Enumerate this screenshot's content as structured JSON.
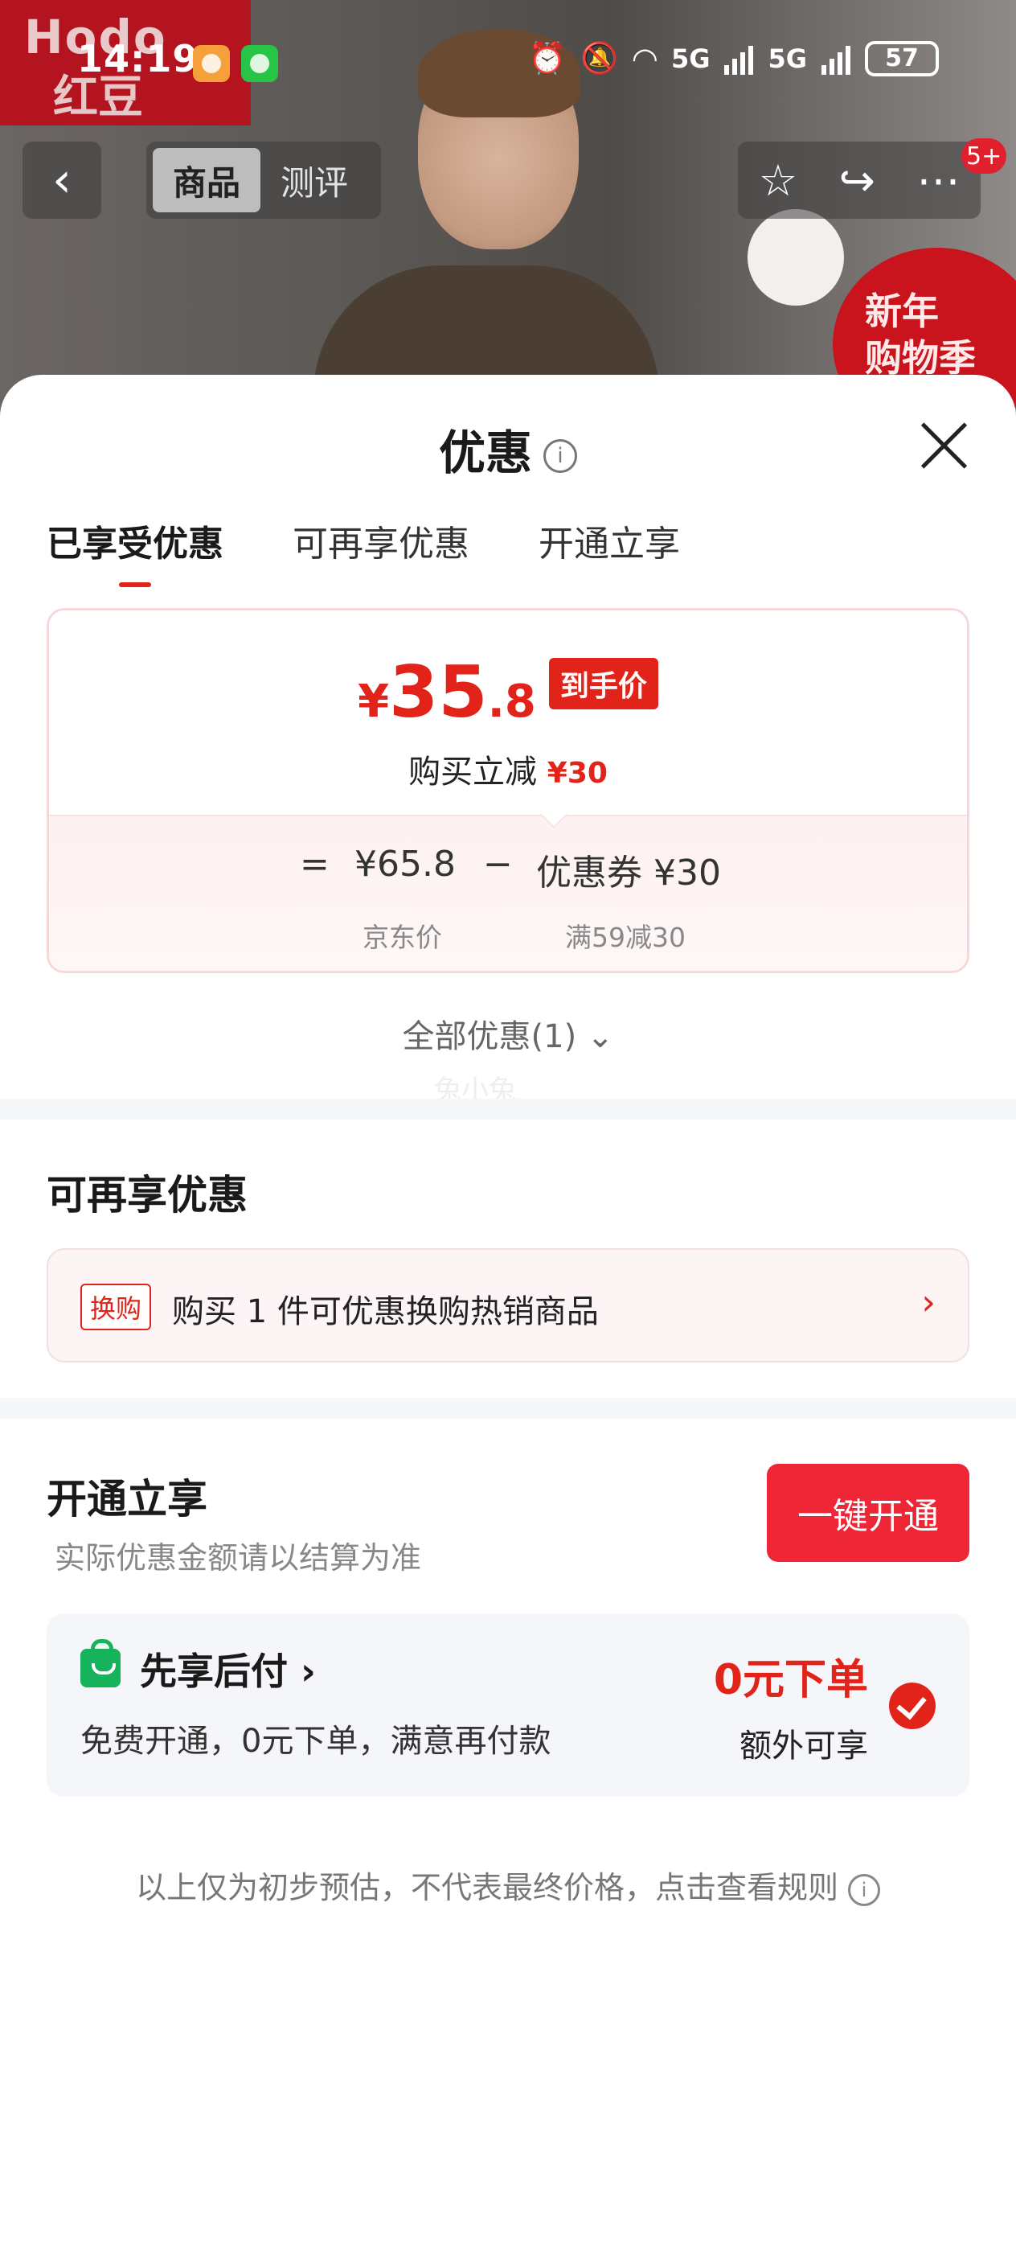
{
  "status_bar": {
    "time": "14:19",
    "network_1": "5G",
    "network_2": "5G",
    "battery": "57"
  },
  "banner": {
    "brand_top": "Hodo",
    "brand_cn": "红豆",
    "promo": [
      "新年",
      "购物季"
    ],
    "badge_count": "5+"
  },
  "top_nav": {
    "back_icon": "back-arrow-icon",
    "tabs": [
      "商品",
      "测评"
    ],
    "active_tab": 0,
    "action_icons": [
      "star-icon",
      "share-icon",
      "more-icon"
    ]
  },
  "sheet": {
    "title": "优惠",
    "tabs": [
      "已享受优惠",
      "可再享优惠",
      "开通立享"
    ],
    "active_tab": 0,
    "price_card": {
      "currency": "¥",
      "price_int": "35",
      "price_dec": ".8",
      "final_tag": "到手价",
      "sub_label": "购买立减",
      "sub_amount": "¥30",
      "eq": "=",
      "jd_price": "¥65.8",
      "minus": "−",
      "coupon": "优惠券 ¥30",
      "jd_price_label": "京东价",
      "coupon_rule": "满59减30"
    },
    "all_offers": "全部优惠(1)",
    "watermark": "兔小兔",
    "more_offers": {
      "title": "可再享优惠",
      "swap_tag": "换购",
      "swap_text": "购买 1 件可优惠换购热销商品"
    },
    "open_section": {
      "title": "开通立享",
      "subtitle": "实际优惠金额请以结算为准",
      "button": "一键开通",
      "pay_later": {
        "title": "先享后付",
        "desc": "免费开通，0元下单，满意再付款",
        "price": "0元下单",
        "extra": "额外可享"
      }
    },
    "disclaimer": "以上仅为初步预估，不代表最终价格，点击查看规则"
  },
  "colors": {
    "accent_red": "#e2231a",
    "button_red": "#ee2636",
    "pay_green": "#17b25c"
  }
}
